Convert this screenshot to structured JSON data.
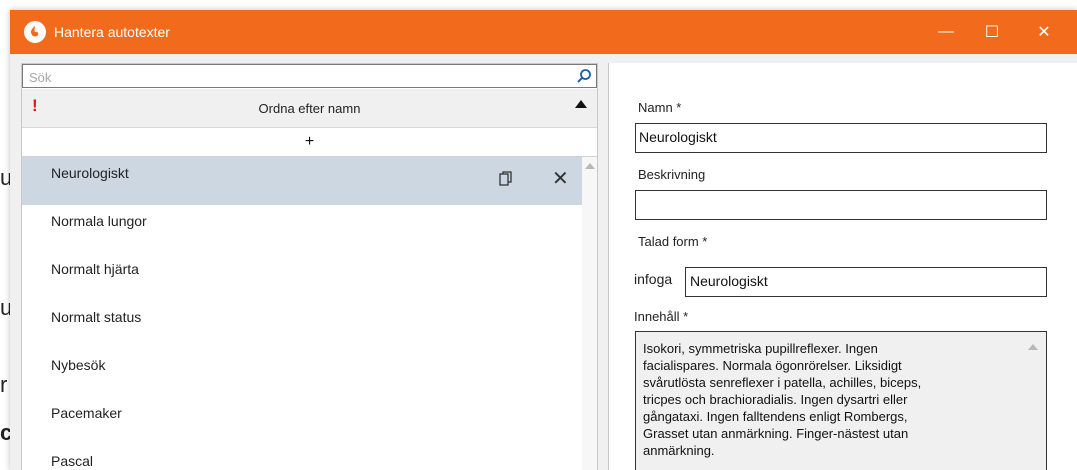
{
  "window": {
    "title": "Hantera autotexter",
    "controls": {
      "minimize": "—",
      "maximize": "☐",
      "close": "✕"
    }
  },
  "background_fragments": [
    "u",
    "u",
    "r",
    "c"
  ],
  "search": {
    "placeholder": "Sök",
    "value": ""
  },
  "sort": {
    "label": "Ordna efter namn",
    "warning": "!"
  },
  "add_label": "+",
  "list": {
    "items": [
      {
        "label": "Neurologiskt",
        "selected": true
      },
      {
        "label": "Normala lungor"
      },
      {
        "label": "Normalt hjärta"
      },
      {
        "label": "Normalt status"
      },
      {
        "label": "Nybesök"
      },
      {
        "label": "Pacemaker"
      },
      {
        "label": "Pascal"
      }
    ],
    "delete_glyph": "✕"
  },
  "form": {
    "name_label": "Namn *",
    "name_value": "Neurologiskt",
    "description_label": "Beskrivning",
    "description_value": "",
    "spoken_label": "Talad form *",
    "spoken_prefix": "infoga",
    "spoken_value": "Neurologiskt",
    "content_label": "Innehåll *",
    "content_lines": [
      "Isokori, symmetriska pupillreflexer. Ingen",
      "facialispares. Normala ögonrörelser. Liksidigt",
      "svårutlösta senreflexer i patella, achilles, biceps,",
      "tricpes och brachioradialis. Ingen dysartri eller",
      "gångataxi. Ingen falltendens enligt Rombergs,",
      "Grasset utan anmärkning. Finger-nästest utan",
      "anmärkning."
    ]
  },
  "colors": {
    "titlebar": "#f26a1b",
    "selected_row": "#cdd7e2",
    "warning": "#e01818"
  }
}
